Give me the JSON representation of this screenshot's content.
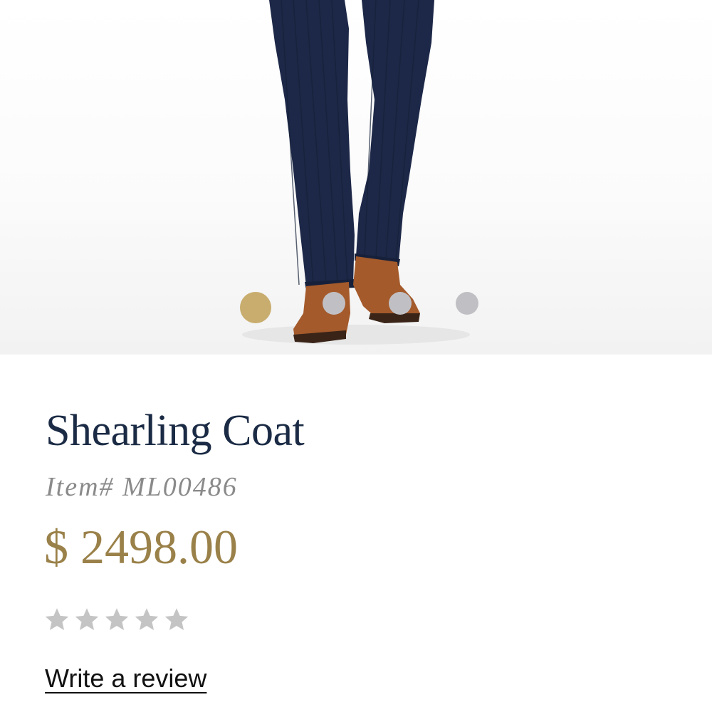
{
  "product": {
    "title": "Shearling Coat",
    "item_number": "Item# ML00486",
    "price": "$ 2498.00",
    "rating": {
      "stars_total": 5,
      "stars_filled": 0,
      "empty_color": "#c4c4c4"
    },
    "write_review_label": "Write a review"
  },
  "gallery": {
    "dot_count": 4,
    "active_index": 0,
    "active_color": "#c8ad6e",
    "inactive_color": "#c0c0c4"
  },
  "colors": {
    "title": "#1b2b45",
    "item_number": "#8a8a8a",
    "price": "#9a8149",
    "trousers": "#1d2848",
    "shoes": "#a45a2b"
  }
}
